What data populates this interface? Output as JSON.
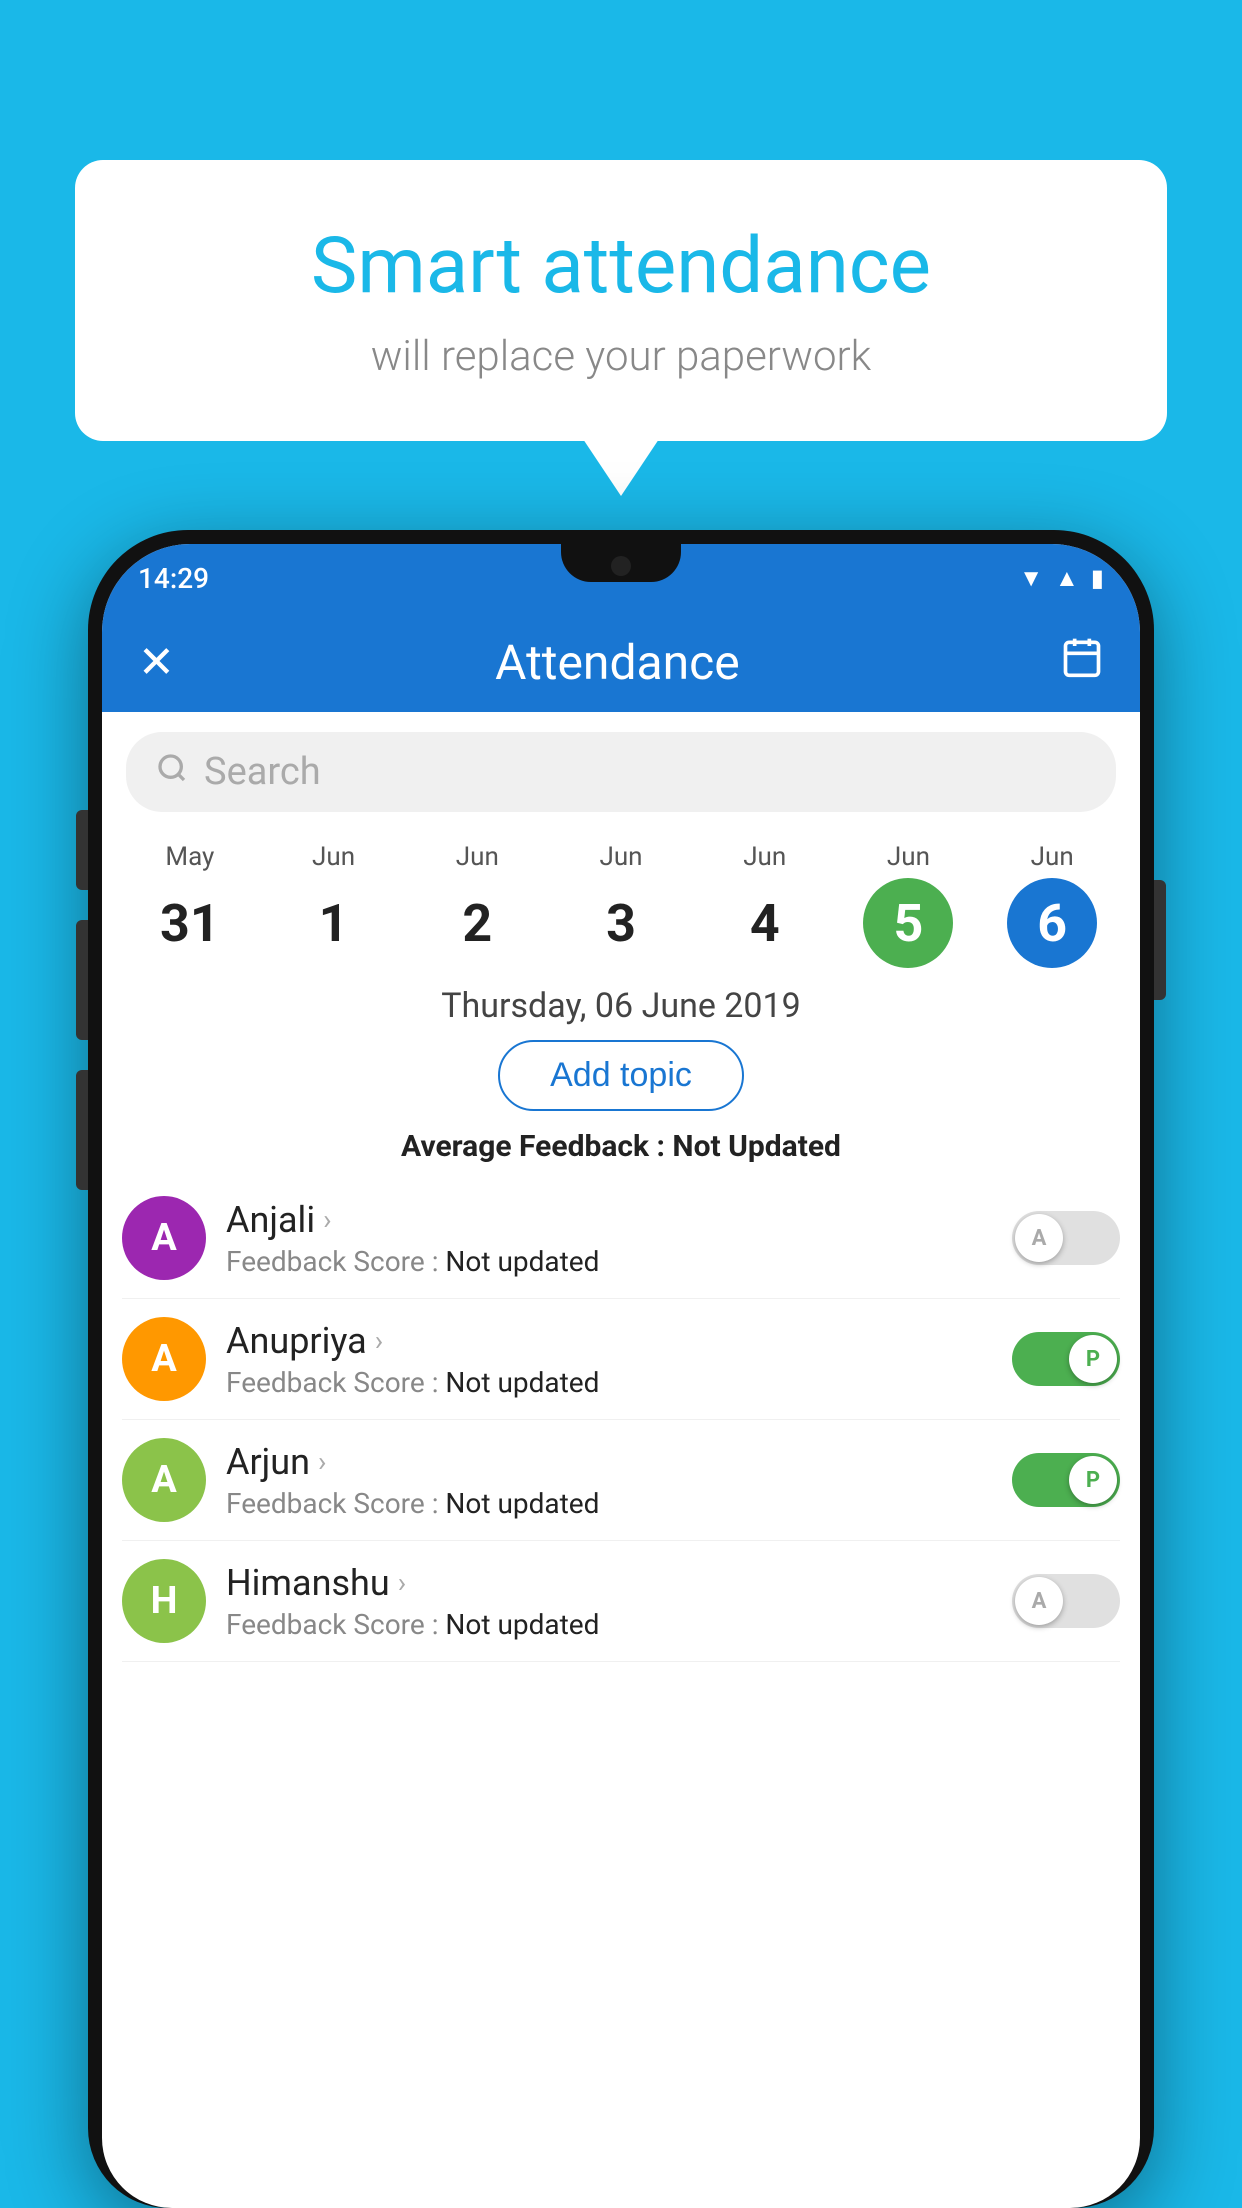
{
  "background_color": "#1ab8e8",
  "speech_bubble": {
    "title": "Smart attendance",
    "subtitle": "will replace your paperwork"
  },
  "status_bar": {
    "time": "14:29",
    "icons": [
      "wifi",
      "signal",
      "battery"
    ]
  },
  "app_bar": {
    "title": "Attendance",
    "close_icon": "✕",
    "calendar_icon": "📅"
  },
  "search": {
    "placeholder": "Search"
  },
  "calendar": {
    "days": [
      {
        "month": "May",
        "day": "31",
        "selected": false
      },
      {
        "month": "Jun",
        "day": "1",
        "selected": false
      },
      {
        "month": "Jun",
        "day": "2",
        "selected": false
      },
      {
        "month": "Jun",
        "day": "3",
        "selected": false
      },
      {
        "month": "Jun",
        "day": "4",
        "selected": false
      },
      {
        "month": "Jun",
        "day": "5",
        "selected": "green"
      },
      {
        "month": "Jun",
        "day": "6",
        "selected": "blue"
      }
    ]
  },
  "selected_date": "Thursday, 06 June 2019",
  "add_topic_label": "Add topic",
  "avg_feedback_label": "Average Feedback :",
  "avg_feedback_value": "Not Updated",
  "students": [
    {
      "name": "Anjali",
      "avatar_letter": "A",
      "avatar_color": "#9c27b0",
      "feedback_label": "Feedback Score :",
      "feedback_value": "Not updated",
      "toggle_state": "off",
      "toggle_label": "A"
    },
    {
      "name": "Anupriya",
      "avatar_letter": "A",
      "avatar_color": "#ff9800",
      "feedback_label": "Feedback Score :",
      "feedback_value": "Not updated",
      "toggle_state": "on",
      "toggle_label": "P"
    },
    {
      "name": "Arjun",
      "avatar_letter": "A",
      "avatar_color": "#8bc34a",
      "feedback_label": "Feedback Score :",
      "feedback_value": "Not updated",
      "toggle_state": "on",
      "toggle_label": "P"
    },
    {
      "name": "Himanshu",
      "avatar_letter": "H",
      "avatar_color": "#8bc34a",
      "feedback_label": "Feedback Score :",
      "feedback_value": "Not updated",
      "toggle_state": "off",
      "toggle_label": "A"
    }
  ]
}
